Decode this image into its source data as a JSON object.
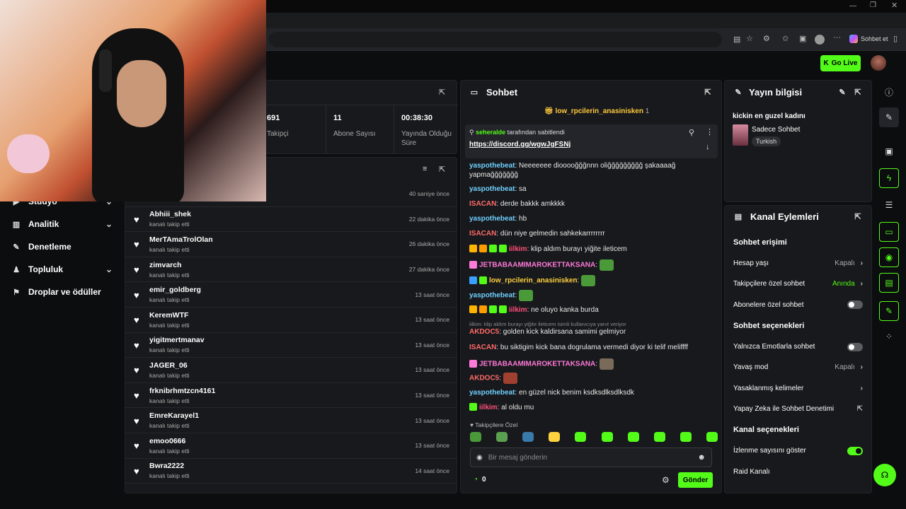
{
  "browser": {
    "chat_btn": "Sohbet et"
  },
  "header": {
    "go_live": "Go Live"
  },
  "stats": [
    {
      "value": "691",
      "label": "Takipçi"
    },
    {
      "value": "11",
      "label": "Abone Sayısı"
    },
    {
      "value": "00:38:30",
      "label": "Yayında Olduğu Süre"
    }
  ],
  "sidebar": {
    "items": [
      {
        "label": "Stüdyo"
      },
      {
        "label": "Analitik"
      },
      {
        "label": "Denetleme"
      },
      {
        "label": "Topluluk"
      },
      {
        "label": "Droplar ve ödüller"
      }
    ]
  },
  "followers": {
    "sub_text": "kanalı takip etti",
    "rows": [
      {
        "name": "",
        "time": "40 saniye önce"
      },
      {
        "name": "Abhiii_shek",
        "time": "22 dakika önce"
      },
      {
        "name": "MerTAmaTrolOlan",
        "time": "26 dakika önce"
      },
      {
        "name": "zimvarch",
        "time": "27 dakika önce"
      },
      {
        "name": "emir_goldberg",
        "time": "13 saat önce"
      },
      {
        "name": "KeremWTF",
        "time": "13 saat önce"
      },
      {
        "name": "yigitmertmanav",
        "time": "13 saat önce"
      },
      {
        "name": "JAGER_06",
        "time": "13 saat önce"
      },
      {
        "name": "frknibrhmtzcn4161",
        "time": "13 saat önce"
      },
      {
        "name": "EmreKarayel1",
        "time": "13 saat önce"
      },
      {
        "name": "emoo0666",
        "time": "13 saat önce"
      },
      {
        "name": "Bwra2222",
        "time": "14 saat önce"
      }
    ]
  },
  "chat": {
    "title": "Sohbet",
    "top_user": "low_rpcilerin_anasinisken",
    "top_count": "1",
    "pinned": {
      "user": "seheralde",
      "by": "tarafından sabitlendi",
      "link": "https://discord.gg/wgwJgFSNj"
    },
    "messages": [
      {
        "user": "yaspothebeat",
        "color": "#6fd0ff",
        "text": ": Neeeeeee diooooğğğnnn oliğğğğğğğğğ şakaaaağ yapmağğğğğğğ"
      },
      {
        "user": "yaspothebeat",
        "color": "#6fd0ff",
        "text": ": sa"
      },
      {
        "user": "ISACAN",
        "color": "#ff6a6a",
        "text": ": derde bakkk amkkkk"
      },
      {
        "user": "yaspothebeat",
        "color": "#6fd0ff",
        "text": ": hb"
      },
      {
        "user": "ISACAN",
        "color": "#ff6a6a",
        "text": ": dün niye gelmedin sahkekarrrrrrrr"
      },
      {
        "user": "iilkim",
        "color": "#ff4f7a",
        "text": ": klip aldım burayı yiğite ileticem"
      },
      {
        "user": "JETBABAAMIMAROKETTAKSANA",
        "color": "#ff7ad9",
        "text": ":"
      },
      {
        "user": "low_rpcilerin_anasinisken",
        "color": "#ffd23f",
        "text": ":"
      },
      {
        "user": "yaspothebeat",
        "color": "#6fd0ff",
        "text": ":"
      },
      {
        "user": "iilkim",
        "color": "#ff4f7a",
        "text": ": ne oluyo kanka burda"
      },
      {
        "user": "AKDOC5",
        "color": "#ff6a6a",
        "text": ": golden kick kaldirsana samimi gelmiyor"
      },
      {
        "user": "ISACAN",
        "color": "#ff6a6a",
        "text": ": bu siktigim kick bana dogrulama vermedi diyor ki telif meliffff"
      },
      {
        "user": "JETBABAAMIMAROKETTAKSANA",
        "color": "#ff7ad9",
        "text": ":"
      },
      {
        "user": "AKDOC5",
        "color": "#ff6a6a",
        "text": ":"
      },
      {
        "user": "yaspothebeat",
        "color": "#6fd0ff",
        "text": ": en güzel nick benim ksdksdlksdlksdk"
      },
      {
        "user": "iilkim",
        "color": "#ff4f7a",
        "text": ": al oldu mu"
      }
    ],
    "reply_hint": "iilkim: klip aldım burayı yiğite ileticem isimli kullanıcıya yanıt veriyor",
    "followers_only": "Takipçilere Özel",
    "input_placeholder": "Bir mesaj gönderin",
    "count": "0",
    "send": "Gönder"
  },
  "stream_info": {
    "title": "Yayın bilgisi",
    "stream_title": "kickin en guzel kadını",
    "category": "Sadece Sohbet",
    "tag": "Turkish"
  },
  "channel_actions": {
    "title": "Kanal Eylemleri",
    "section1": "Sohbet erişimi",
    "age": {
      "label": "Hesap yaşı",
      "value": "Kapalı"
    },
    "followers_chat": {
      "label": "Takipçilere özel sohbet",
      "value": "Anında"
    },
    "subs_chat": {
      "label": "Abonelere özel sohbet"
    },
    "section2": "Sohbet seçenekleri",
    "emotes_only": {
      "label": "Yalnızca Emotlarla sohbet"
    },
    "slow": {
      "label": "Yavaş mod",
      "value": "Kapalı"
    },
    "banned": {
      "label": "Yasaklanmış kelimeler"
    },
    "ai": {
      "label": "Yapay Zeka ile Sohbet Denetimi"
    },
    "section3": "Kanal seçenekleri",
    "viewcount": {
      "label": "İzlenme sayısını göster"
    },
    "raid": {
      "label": "Raid Kanalı"
    }
  },
  "colors": {
    "accent": "#53fc18",
    "panel": "#18191c",
    "bg": "#0c0d0f"
  }
}
